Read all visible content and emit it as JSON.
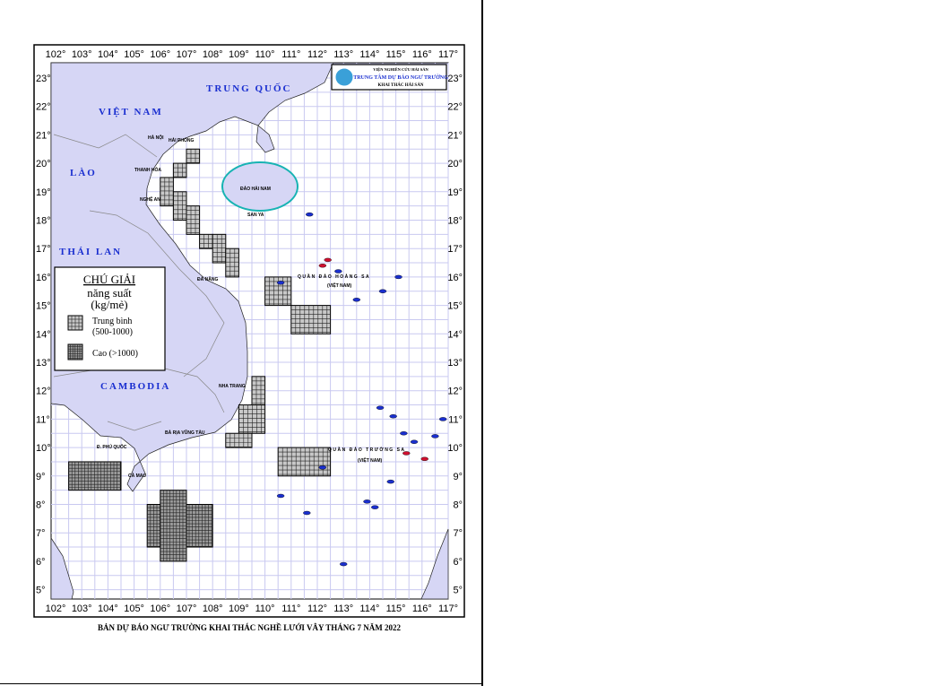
{
  "caption": "BẢN DỰ BÁO NGƯ TRƯỜNG KHAI THÁC NGHỀ LƯỚI VÂY THÁNG 7 NĂM 2022",
  "logo": {
    "line1": "VIỆN NGHIÊN CỨU HẢI SẢN",
    "line2": "TRUNG TÂM DỰ BÁO NGƯ TRƯỜNG",
    "line3": "KHAI THÁC HẢI SẢN"
  },
  "legend": {
    "title": "CHÚ GIẢI",
    "subtitle1": "năng suất",
    "subtitle2": "(kg/mẻ)",
    "medium_label1": "Trung bình",
    "medium_label2": "(500-1000)",
    "high_label": "Cao (>1000)"
  },
  "lon_ticks": [
    "102°",
    "103°",
    "104°",
    "105°",
    "106°",
    "107°",
    "108°",
    "109°",
    "110°",
    "111°",
    "112°",
    "113°",
    "114°",
    "115°",
    "116°",
    "117°"
  ],
  "lat_ticks": [
    "23°",
    "22°",
    "21°",
    "20°",
    "19°",
    "18°",
    "17°",
    "16°",
    "15°",
    "14°",
    "13°",
    "12°",
    "11°",
    "10°",
    "9°",
    "8°",
    "7°",
    "6°",
    "5°"
  ],
  "countries": {
    "china": "TRUNG QUỐC",
    "vietnam": "VIỆT NAM",
    "laos": "LÀO",
    "thailand": "THÁI LAN",
    "cambodia": "CAMBODIA"
  },
  "places": {
    "hanoi": "HÀ NỘI",
    "haiphong": "HẢI PHÒNG",
    "thanhhoa": "THANH HÓA",
    "nghean": "NGHỆ AN",
    "danang": "ĐÀ NẴNG",
    "nhatrang": "NHA TRANG",
    "vungtau": "BÀ RỊA VŨNG TÀU",
    "camau": "CÀ MAU",
    "phuquoc": "Đ. PHÚ QUỐC",
    "hainan": "ĐẢO HẢI NAM",
    "sanya": "SAN YA",
    "hoangsa": "QUẦN ĐẢO HOÀNG SA",
    "hoangsa_vn": "(VIỆT NAM)",
    "truongsa": "QUẦN ĐẢO TRƯỜNG SA",
    "truongsa_vn": "(VIỆT NAM)"
  },
  "colors": {
    "land": "#d6d6f5",
    "grid": "#c9c9f0",
    "country_label": "#1a2fd0",
    "hainan_coast": "#17b3b3"
  },
  "cells": {
    "medium": [
      [
        107,
        20,
        107.5,
        20.5
      ],
      [
        106.5,
        19.5,
        107,
        20
      ],
      [
        106,
        18.5,
        106.5,
        19.5
      ],
      [
        106.5,
        18,
        107,
        19
      ],
      [
        107,
        17.5,
        107.5,
        18.5
      ],
      [
        107.5,
        17,
        108,
        17.5
      ],
      [
        108,
        16.5,
        108.5,
        17.5
      ],
      [
        108.5,
        16,
        109,
        17
      ],
      [
        110,
        15,
        111,
        16
      ],
      [
        111,
        14,
        112.5,
        15
      ],
      [
        109.5,
        11.5,
        110,
        12.5
      ],
      [
        109,
        10.5,
        110,
        11.5
      ],
      [
        108.5,
        10,
        109.5,
        10.5
      ],
      [
        110.5,
        9,
        112.5,
        10
      ]
    ],
    "high": [
      [
        102.5,
        8.5,
        104.5,
        9.5
      ],
      [
        105.5,
        6.5,
        108,
        8
      ],
      [
        106,
        6,
        107,
        8.5
      ]
    ]
  }
}
